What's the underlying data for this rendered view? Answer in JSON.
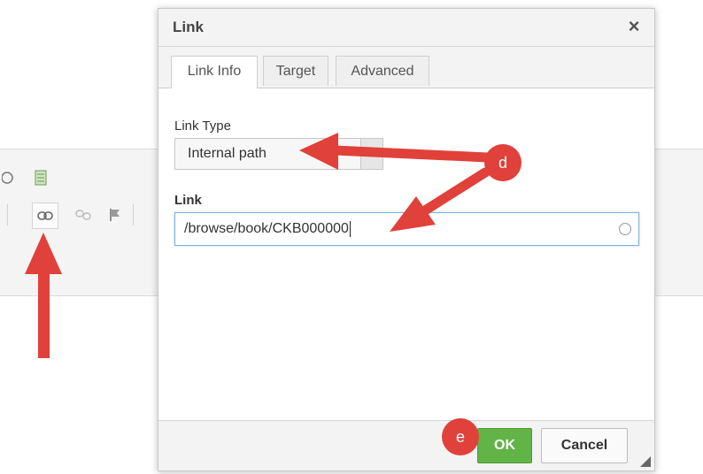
{
  "dialog": {
    "title": "Link",
    "close_icon": "×",
    "tabs": [
      {
        "label": "Link Info",
        "active": true
      },
      {
        "label": "Target",
        "active": false
      },
      {
        "label": "Advanced",
        "active": false
      }
    ],
    "link_type": {
      "label": "Link Type",
      "value": "Internal path"
    },
    "link": {
      "label": "Link",
      "value": "/browse/book/CKB000000"
    },
    "buttons": {
      "ok": "OK",
      "cancel": "Cancel"
    }
  },
  "toolbar": {
    "icons": [
      "source-icon",
      "template-icon",
      "link-icon",
      "unlink-icon",
      "anchor-icon"
    ]
  },
  "annotations": {
    "badge_d": "d",
    "badge_e": "e",
    "arrow_color": "#e0413a"
  },
  "colors": {
    "ok_button": "#62b447",
    "input_focus_border": "#7fb3d9"
  }
}
